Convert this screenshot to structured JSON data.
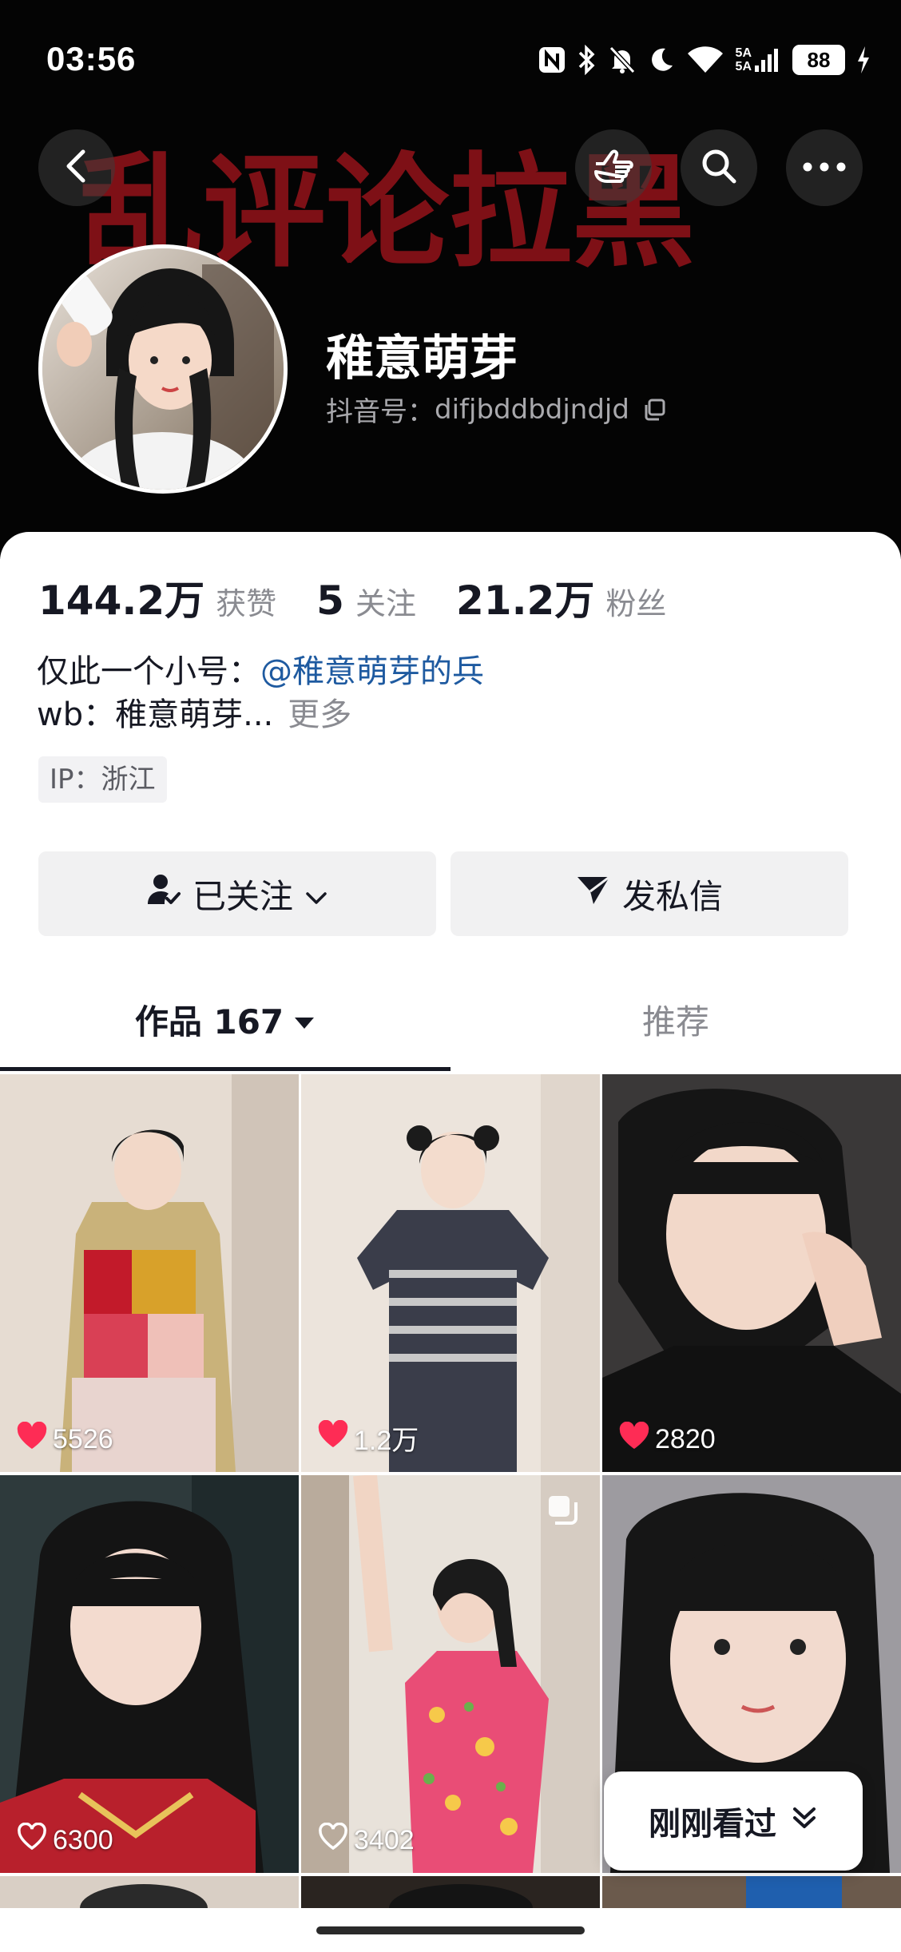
{
  "status_bar": {
    "time": "03:56",
    "network": "5A",
    "battery": "88",
    "icons": [
      "nfc-icon",
      "bluetooth-icon",
      "mute-icon",
      "moon-icon",
      "wifi-icon",
      "signal-icon",
      "battery-icon",
      "charging-icon"
    ]
  },
  "cover": {
    "slogan": "乱评论拉黑"
  },
  "header_nav": {
    "icons": [
      "back-icon",
      "hand-point-icon",
      "search-icon",
      "more-icon"
    ]
  },
  "profile": {
    "name": "稚意萌芽",
    "douyin_id_label": "抖音号：",
    "douyin_id": "difjbddbdjndjd",
    "stats": [
      {
        "value": "144.2万",
        "label": "获赞"
      },
      {
        "value": "5",
        "label": "关注"
      },
      {
        "value": "21.2万",
        "label": "粉丝"
      }
    ],
    "bio_prefix": "仅此一个小号：",
    "bio_mention": "@稚意萌芽的兵",
    "bio_line2": "wb：稚意萌芽...",
    "more": "更多",
    "ip": "IP：浙江"
  },
  "actions": {
    "follow_label": "已关注",
    "message_label": "发私信"
  },
  "tabs": {
    "works_label": "作品 167",
    "recommend_label": "推荐"
  },
  "videos": [
    {
      "likes": "5526",
      "liked": true
    },
    {
      "likes": "1.2万",
      "liked": true
    },
    {
      "likes": "2820",
      "liked": true
    },
    {
      "likes": "6300",
      "liked": false
    },
    {
      "likes": "3402",
      "liked": false
    },
    {
      "likes": "",
      "liked": false
    }
  ],
  "recent_pill": {
    "label": "刚刚看过"
  },
  "colors": {
    "brand_red": "#fe2c55",
    "mention_blue": "#1e5aa0",
    "slogan_red": "#7e1016"
  }
}
